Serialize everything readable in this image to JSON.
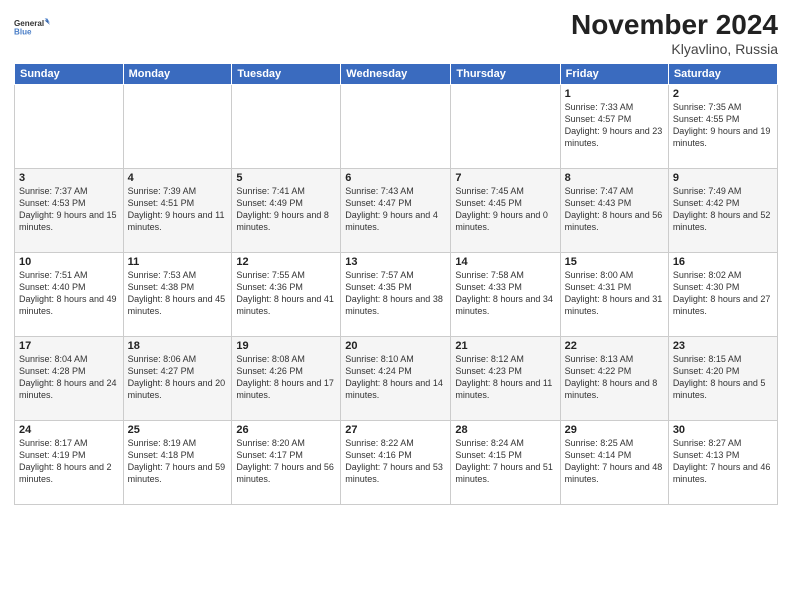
{
  "logo": {
    "line1": "General",
    "line2": "Blue"
  },
  "title": "November 2024",
  "location": "Klyavlino, Russia",
  "days_header": [
    "Sunday",
    "Monday",
    "Tuesday",
    "Wednesday",
    "Thursday",
    "Friday",
    "Saturday"
  ],
  "weeks": [
    [
      {
        "num": "",
        "info": ""
      },
      {
        "num": "",
        "info": ""
      },
      {
        "num": "",
        "info": ""
      },
      {
        "num": "",
        "info": ""
      },
      {
        "num": "",
        "info": ""
      },
      {
        "num": "1",
        "info": "Sunrise: 7:33 AM\nSunset: 4:57 PM\nDaylight: 9 hours and 23 minutes."
      },
      {
        "num": "2",
        "info": "Sunrise: 7:35 AM\nSunset: 4:55 PM\nDaylight: 9 hours and 19 minutes."
      }
    ],
    [
      {
        "num": "3",
        "info": "Sunrise: 7:37 AM\nSunset: 4:53 PM\nDaylight: 9 hours and 15 minutes."
      },
      {
        "num": "4",
        "info": "Sunrise: 7:39 AM\nSunset: 4:51 PM\nDaylight: 9 hours and 11 minutes."
      },
      {
        "num": "5",
        "info": "Sunrise: 7:41 AM\nSunset: 4:49 PM\nDaylight: 9 hours and 8 minutes."
      },
      {
        "num": "6",
        "info": "Sunrise: 7:43 AM\nSunset: 4:47 PM\nDaylight: 9 hours and 4 minutes."
      },
      {
        "num": "7",
        "info": "Sunrise: 7:45 AM\nSunset: 4:45 PM\nDaylight: 9 hours and 0 minutes."
      },
      {
        "num": "8",
        "info": "Sunrise: 7:47 AM\nSunset: 4:43 PM\nDaylight: 8 hours and 56 minutes."
      },
      {
        "num": "9",
        "info": "Sunrise: 7:49 AM\nSunset: 4:42 PM\nDaylight: 8 hours and 52 minutes."
      }
    ],
    [
      {
        "num": "10",
        "info": "Sunrise: 7:51 AM\nSunset: 4:40 PM\nDaylight: 8 hours and 49 minutes."
      },
      {
        "num": "11",
        "info": "Sunrise: 7:53 AM\nSunset: 4:38 PM\nDaylight: 8 hours and 45 minutes."
      },
      {
        "num": "12",
        "info": "Sunrise: 7:55 AM\nSunset: 4:36 PM\nDaylight: 8 hours and 41 minutes."
      },
      {
        "num": "13",
        "info": "Sunrise: 7:57 AM\nSunset: 4:35 PM\nDaylight: 8 hours and 38 minutes."
      },
      {
        "num": "14",
        "info": "Sunrise: 7:58 AM\nSunset: 4:33 PM\nDaylight: 8 hours and 34 minutes."
      },
      {
        "num": "15",
        "info": "Sunrise: 8:00 AM\nSunset: 4:31 PM\nDaylight: 8 hours and 31 minutes."
      },
      {
        "num": "16",
        "info": "Sunrise: 8:02 AM\nSunset: 4:30 PM\nDaylight: 8 hours and 27 minutes."
      }
    ],
    [
      {
        "num": "17",
        "info": "Sunrise: 8:04 AM\nSunset: 4:28 PM\nDaylight: 8 hours and 24 minutes."
      },
      {
        "num": "18",
        "info": "Sunrise: 8:06 AM\nSunset: 4:27 PM\nDaylight: 8 hours and 20 minutes."
      },
      {
        "num": "19",
        "info": "Sunrise: 8:08 AM\nSunset: 4:26 PM\nDaylight: 8 hours and 17 minutes."
      },
      {
        "num": "20",
        "info": "Sunrise: 8:10 AM\nSunset: 4:24 PM\nDaylight: 8 hours and 14 minutes."
      },
      {
        "num": "21",
        "info": "Sunrise: 8:12 AM\nSunset: 4:23 PM\nDaylight: 8 hours and 11 minutes."
      },
      {
        "num": "22",
        "info": "Sunrise: 8:13 AM\nSunset: 4:22 PM\nDaylight: 8 hours and 8 minutes."
      },
      {
        "num": "23",
        "info": "Sunrise: 8:15 AM\nSunset: 4:20 PM\nDaylight: 8 hours and 5 minutes."
      }
    ],
    [
      {
        "num": "24",
        "info": "Sunrise: 8:17 AM\nSunset: 4:19 PM\nDaylight: 8 hours and 2 minutes."
      },
      {
        "num": "25",
        "info": "Sunrise: 8:19 AM\nSunset: 4:18 PM\nDaylight: 7 hours and 59 minutes."
      },
      {
        "num": "26",
        "info": "Sunrise: 8:20 AM\nSunset: 4:17 PM\nDaylight: 7 hours and 56 minutes."
      },
      {
        "num": "27",
        "info": "Sunrise: 8:22 AM\nSunset: 4:16 PM\nDaylight: 7 hours and 53 minutes."
      },
      {
        "num": "28",
        "info": "Sunrise: 8:24 AM\nSunset: 4:15 PM\nDaylight: 7 hours and 51 minutes."
      },
      {
        "num": "29",
        "info": "Sunrise: 8:25 AM\nSunset: 4:14 PM\nDaylight: 7 hours and 48 minutes."
      },
      {
        "num": "30",
        "info": "Sunrise: 8:27 AM\nSunset: 4:13 PM\nDaylight: 7 hours and 46 minutes."
      }
    ]
  ]
}
